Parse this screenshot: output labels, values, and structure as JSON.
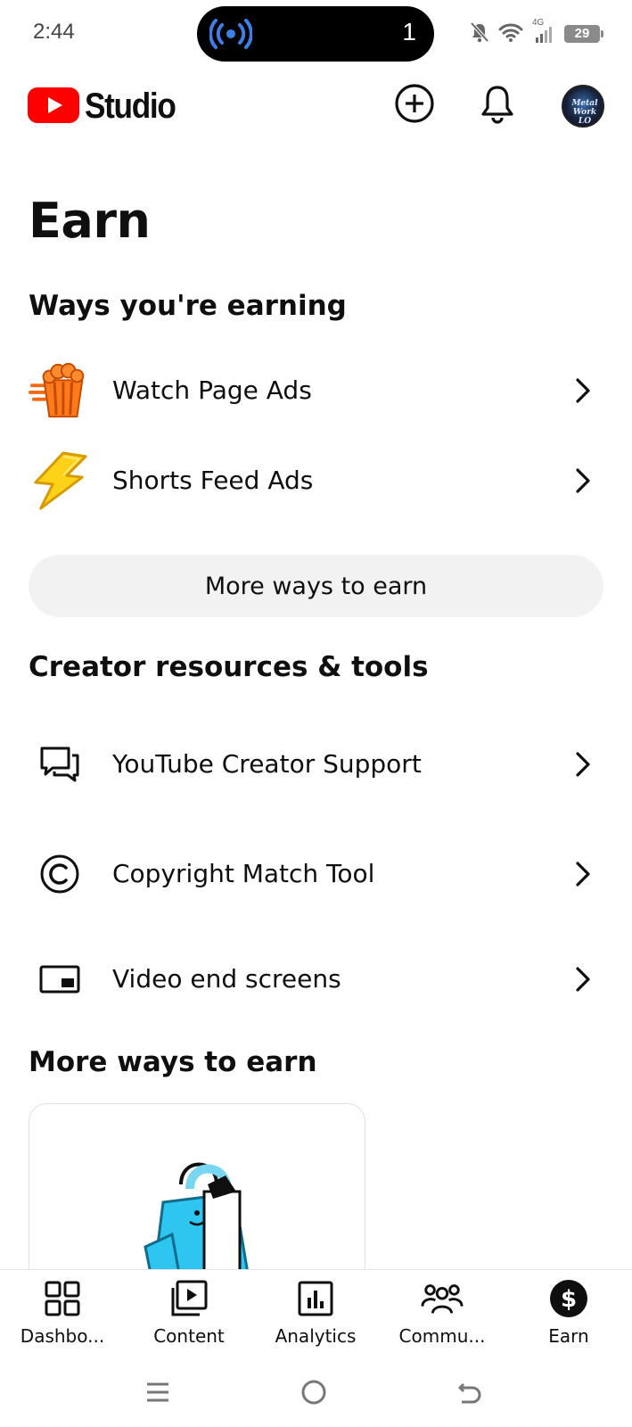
{
  "status_bar": {
    "time": "2:44",
    "pill_count": "1",
    "network": "4G",
    "battery": "29"
  },
  "header": {
    "app_name": "Studio",
    "avatar_text": "Metal Work LO",
    "brand_color": "#FF0000"
  },
  "page": {
    "title": "Earn"
  },
  "earning": {
    "title": "Ways you're earning",
    "items": [
      {
        "label": "Watch Page Ads",
        "icon": "popcorn-icon"
      },
      {
        "label": "Shorts Feed Ads",
        "icon": "lightning-icon"
      }
    ],
    "more_button": "More ways to earn"
  },
  "resources": {
    "title": "Creator resources & tools",
    "items": [
      {
        "label": "YouTube Creator Support",
        "icon": "chat-bubbles-icon"
      },
      {
        "label": "Copyright Match Tool",
        "icon": "copyright-icon"
      },
      {
        "label": "Video end screens",
        "icon": "end-screen-icon"
      }
    ]
  },
  "more_ways": {
    "title": "More ways to earn"
  },
  "bottom_nav": {
    "items": [
      {
        "label": "Dashbo...",
        "icon": "dashboard-icon"
      },
      {
        "label": "Content",
        "icon": "content-icon"
      },
      {
        "label": "Analytics",
        "icon": "analytics-icon"
      },
      {
        "label": "Commu...",
        "icon": "community-icon"
      },
      {
        "label": "Earn",
        "icon": "earn-icon"
      }
    ]
  }
}
